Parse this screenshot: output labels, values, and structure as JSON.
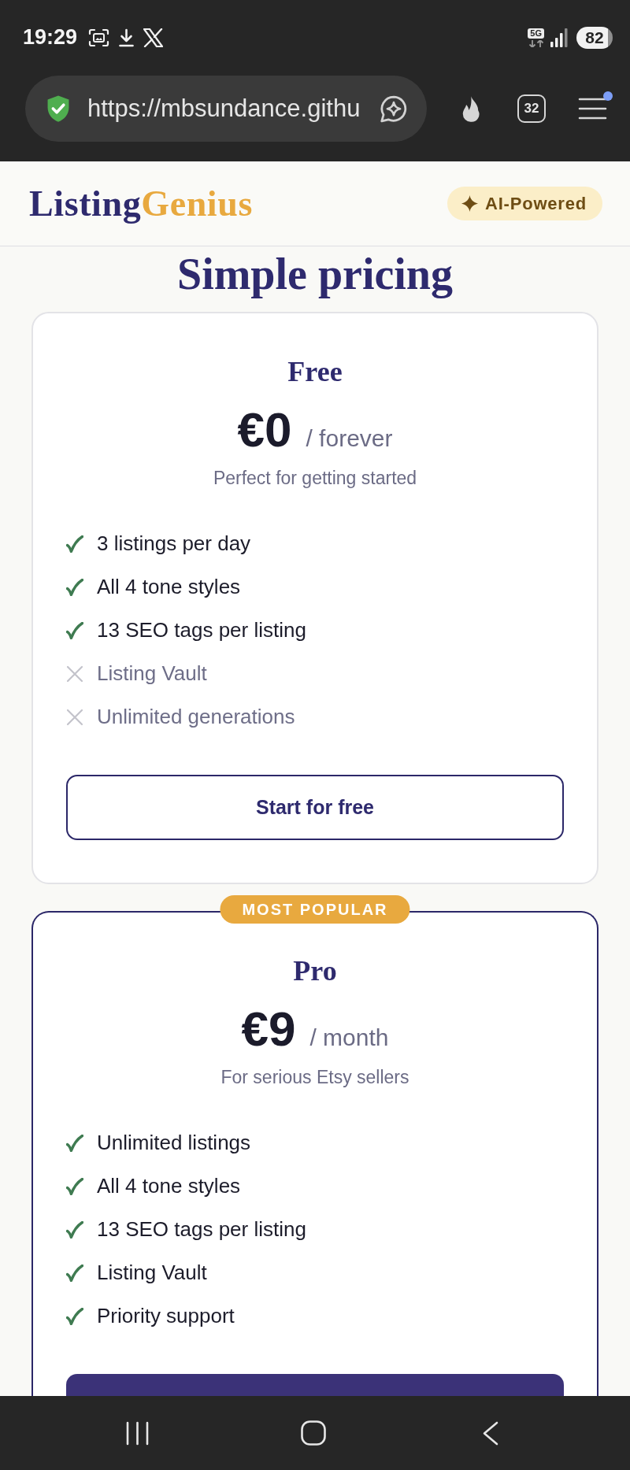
{
  "status_bar": {
    "time": "19:29",
    "network": "5G",
    "battery": "82"
  },
  "browser": {
    "url": "https://mbsundance.githu",
    "tab_count": "32",
    "menu_notification": true
  },
  "header": {
    "logo": {
      "primary": "Listing",
      "accent": "Genius"
    },
    "badge": "AI-Powered"
  },
  "heading": "Simple pricing",
  "plans": [
    {
      "name": "Free",
      "featured": false,
      "price": "€0",
      "period": "/ forever",
      "tagline": "Perfect for getting started",
      "features": [
        {
          "text": "3 listings per day",
          "included": true
        },
        {
          "text": "All 4 tone styles",
          "included": true
        },
        {
          "text": "13 SEO tags per listing",
          "included": true
        },
        {
          "text": "Listing Vault",
          "included": false
        },
        {
          "text": "Unlimited generations",
          "included": false
        }
      ],
      "button": {
        "kind": "outline",
        "label": "Start for free"
      }
    },
    {
      "name": "Pro",
      "featured": true,
      "badge": "MOST POPULAR",
      "price": "€9",
      "period": "/ month",
      "tagline": "For serious Etsy sellers",
      "features": [
        {
          "text": "Unlimited listings",
          "included": true
        },
        {
          "text": "All 4 tone styles",
          "included": true
        },
        {
          "text": "13 SEO tags per listing",
          "included": true
        },
        {
          "text": "Listing Vault",
          "included": true
        },
        {
          "text": "Priority support",
          "included": true
        }
      ],
      "button": {
        "kind": "filled"
      }
    }
  ]
}
